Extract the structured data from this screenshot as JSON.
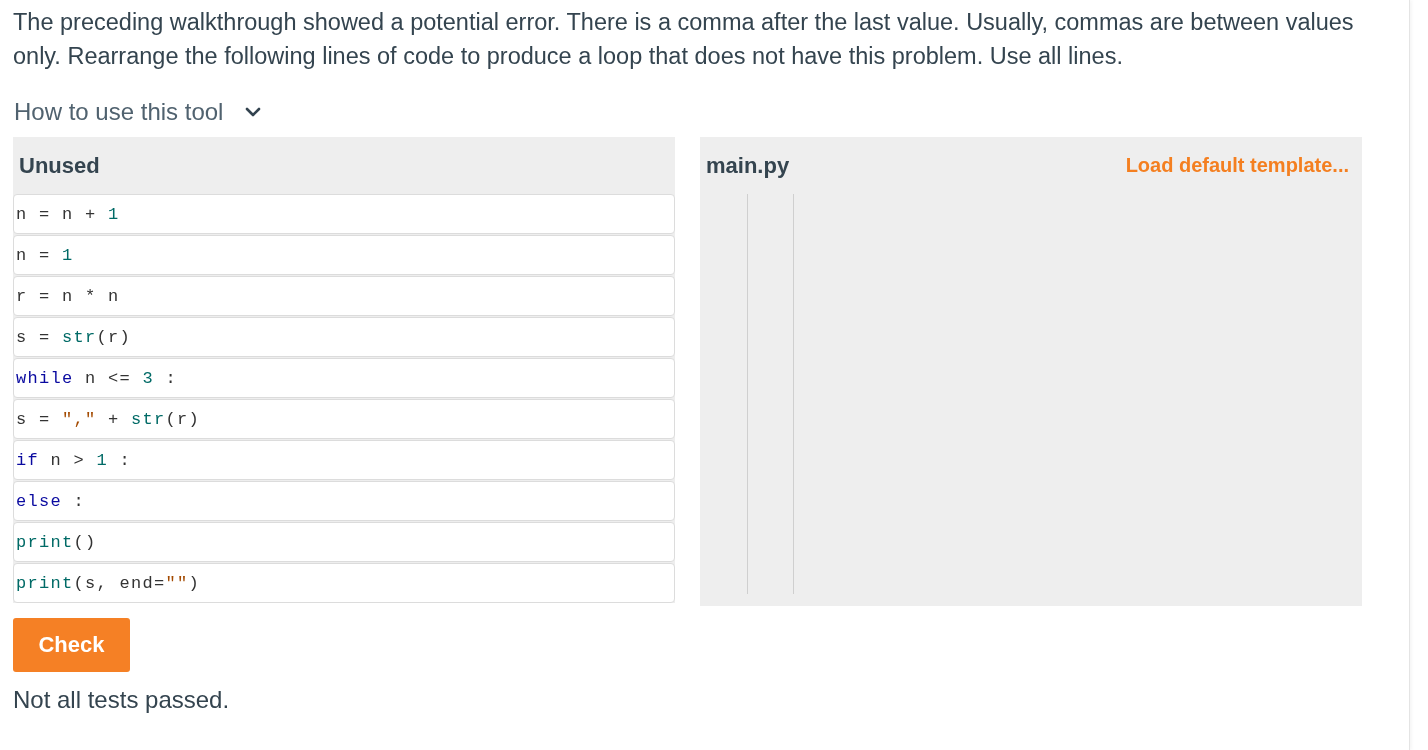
{
  "instructions": "The preceding walkthrough showed a potential error. There is a comma after the last value. Usually, commas are between values only. Rearrange the following lines of code to produce a loop that does not have this problem. Use all lines.",
  "help_toggle": {
    "label": "How to use this tool",
    "expanded": false
  },
  "unused_panel": {
    "title": "Unused",
    "blocks": [
      {
        "tokens": [
          {
            "kind": "plain",
            "text": "n = n + "
          },
          {
            "kind": "number",
            "text": "1"
          }
        ]
      },
      {
        "tokens": [
          {
            "kind": "plain",
            "text": "n = "
          },
          {
            "kind": "number",
            "text": "1"
          }
        ]
      },
      {
        "tokens": [
          {
            "kind": "plain",
            "text": "r = n * n"
          }
        ]
      },
      {
        "tokens": [
          {
            "kind": "plain",
            "text": "s = "
          },
          {
            "kind": "builtin",
            "text": "str"
          },
          {
            "kind": "plain",
            "text": "(r)"
          }
        ]
      },
      {
        "tokens": [
          {
            "kind": "keyword",
            "text": "while"
          },
          {
            "kind": "plain",
            "text": " n <= "
          },
          {
            "kind": "number",
            "text": "3"
          },
          {
            "kind": "plain",
            "text": " :"
          }
        ]
      },
      {
        "tokens": [
          {
            "kind": "plain",
            "text": "s = "
          },
          {
            "kind": "string",
            "text": "\",\""
          },
          {
            "kind": "plain",
            "text": " + "
          },
          {
            "kind": "builtin",
            "text": "str"
          },
          {
            "kind": "plain",
            "text": "(r)"
          }
        ]
      },
      {
        "tokens": [
          {
            "kind": "keyword",
            "text": "if"
          },
          {
            "kind": "plain",
            "text": " n > "
          },
          {
            "kind": "number",
            "text": "1"
          },
          {
            "kind": "plain",
            "text": " :"
          }
        ]
      },
      {
        "tokens": [
          {
            "kind": "keyword",
            "text": "else"
          },
          {
            "kind": "plain",
            "text": " :"
          }
        ]
      },
      {
        "tokens": [
          {
            "kind": "builtin",
            "text": "print"
          },
          {
            "kind": "plain",
            "text": "()"
          }
        ]
      },
      {
        "tokens": [
          {
            "kind": "builtin",
            "text": "print"
          },
          {
            "kind": "plain",
            "text": "(s, end="
          },
          {
            "kind": "string",
            "text": "\"\""
          },
          {
            "kind": "plain",
            "text": ")"
          }
        ]
      }
    ]
  },
  "editor_panel": {
    "title": "main.py",
    "load_template_link": "Load default template..."
  },
  "check_button": {
    "label": "Check"
  },
  "result": "Not all tests passed."
}
